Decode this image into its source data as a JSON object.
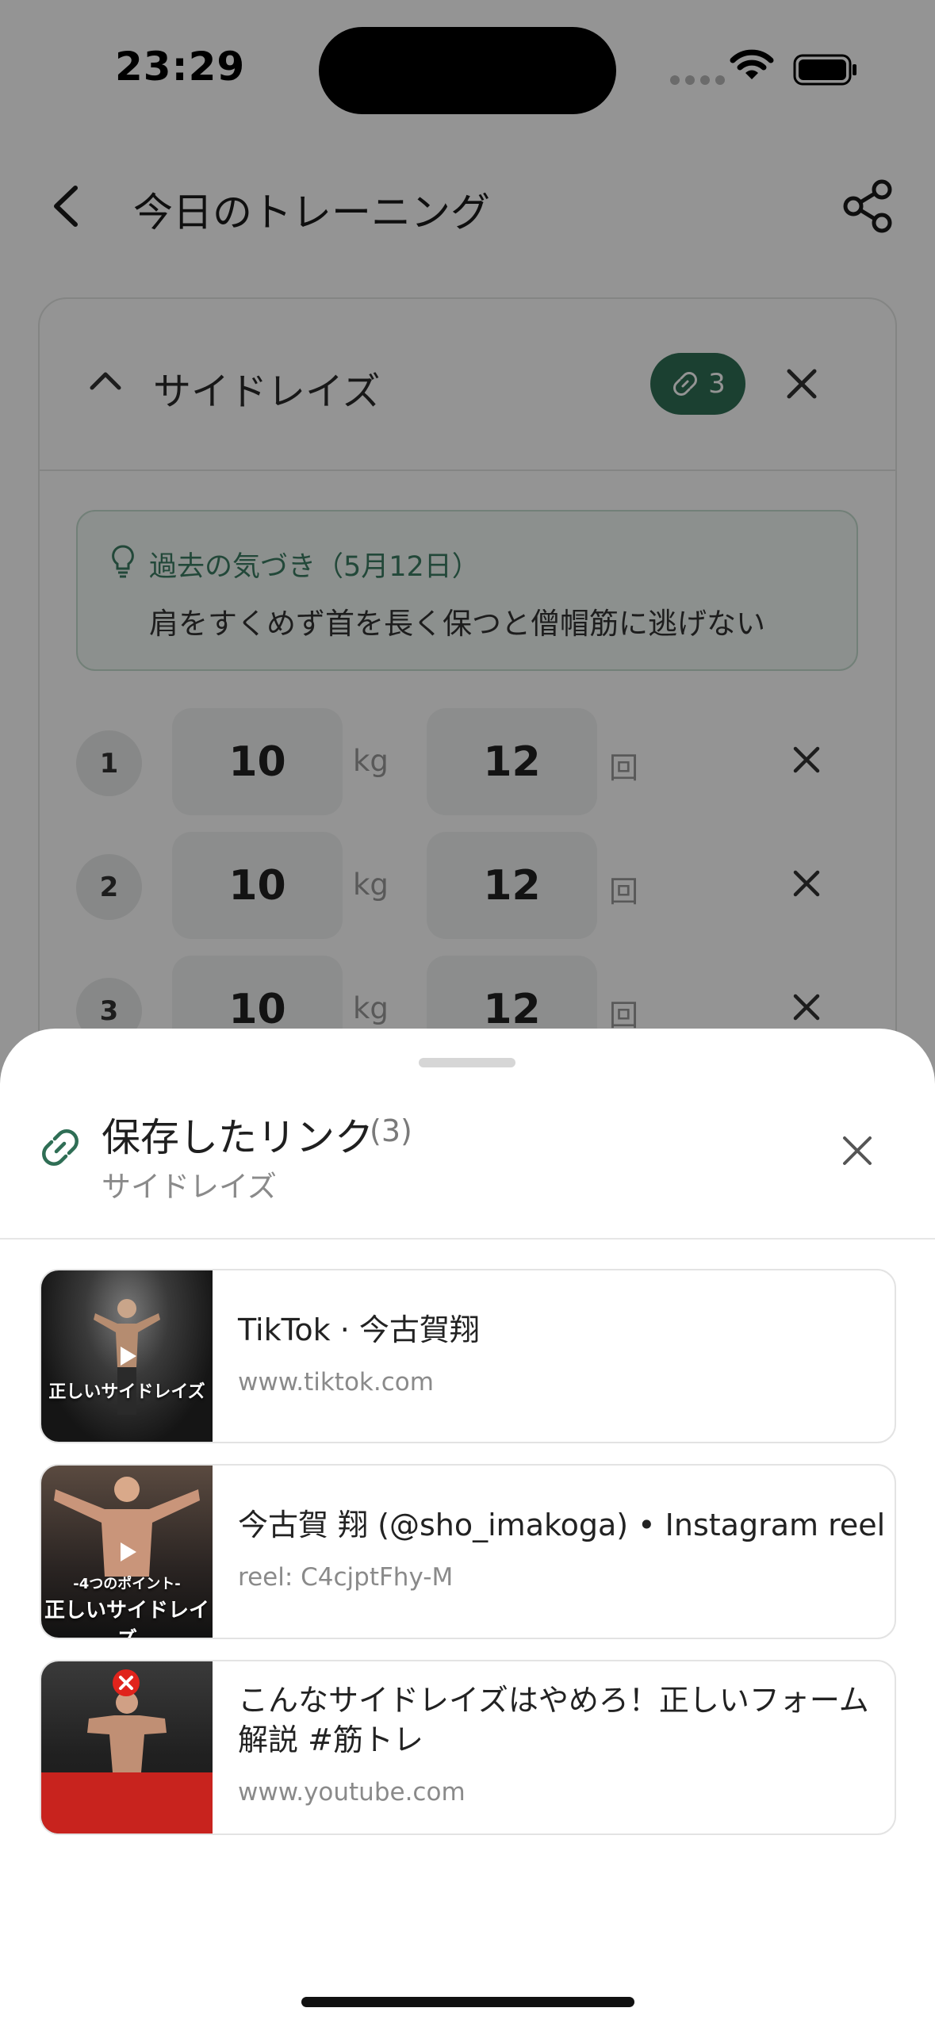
{
  "status": {
    "time": "23:29"
  },
  "header": {
    "title": "今日のトレーニング"
  },
  "exercise": {
    "name": "サイドレイズ",
    "link_count": "3",
    "insight_label": "過去の気づき（5月12日）",
    "insight_text": "肩をすくめず首を長く保つと僧帽筋に逃げない",
    "sets": [
      {
        "number": "1",
        "weight": "10",
        "weight_unit": "kg",
        "reps": "12",
        "reps_unit": "回"
      },
      {
        "number": "2",
        "weight": "10",
        "weight_unit": "kg",
        "reps": "12",
        "reps_unit": "回"
      },
      {
        "number": "3",
        "weight": "10",
        "weight_unit": "kg",
        "reps": "12",
        "reps_unit": "回"
      }
    ]
  },
  "sheet": {
    "title": "保存したリンク",
    "count": "(3)",
    "subtitle": "サイドレイズ",
    "links": [
      {
        "title": "TikTok · 今古賀翔",
        "url": "www.tiktok.com",
        "thumb_caption": "正しいサイドレイズ"
      },
      {
        "title": "今古賀 翔 (@sho_imakoga) • Instagram reel",
        "url": "reel: C4cjptFhy-M",
        "thumb_caption_top": "-4つのポイント-",
        "thumb_caption": "正しいサイドレイズ"
      },
      {
        "title_line1": "こんなサイドレイズはやめろ！正しいフォーム",
        "title_line2": "解説 #筋トレ",
        "url": "www.youtube.com"
      }
    ]
  },
  "colors": {
    "accent": "#2f6e55",
    "insight_bg": "#f1f8f4"
  }
}
